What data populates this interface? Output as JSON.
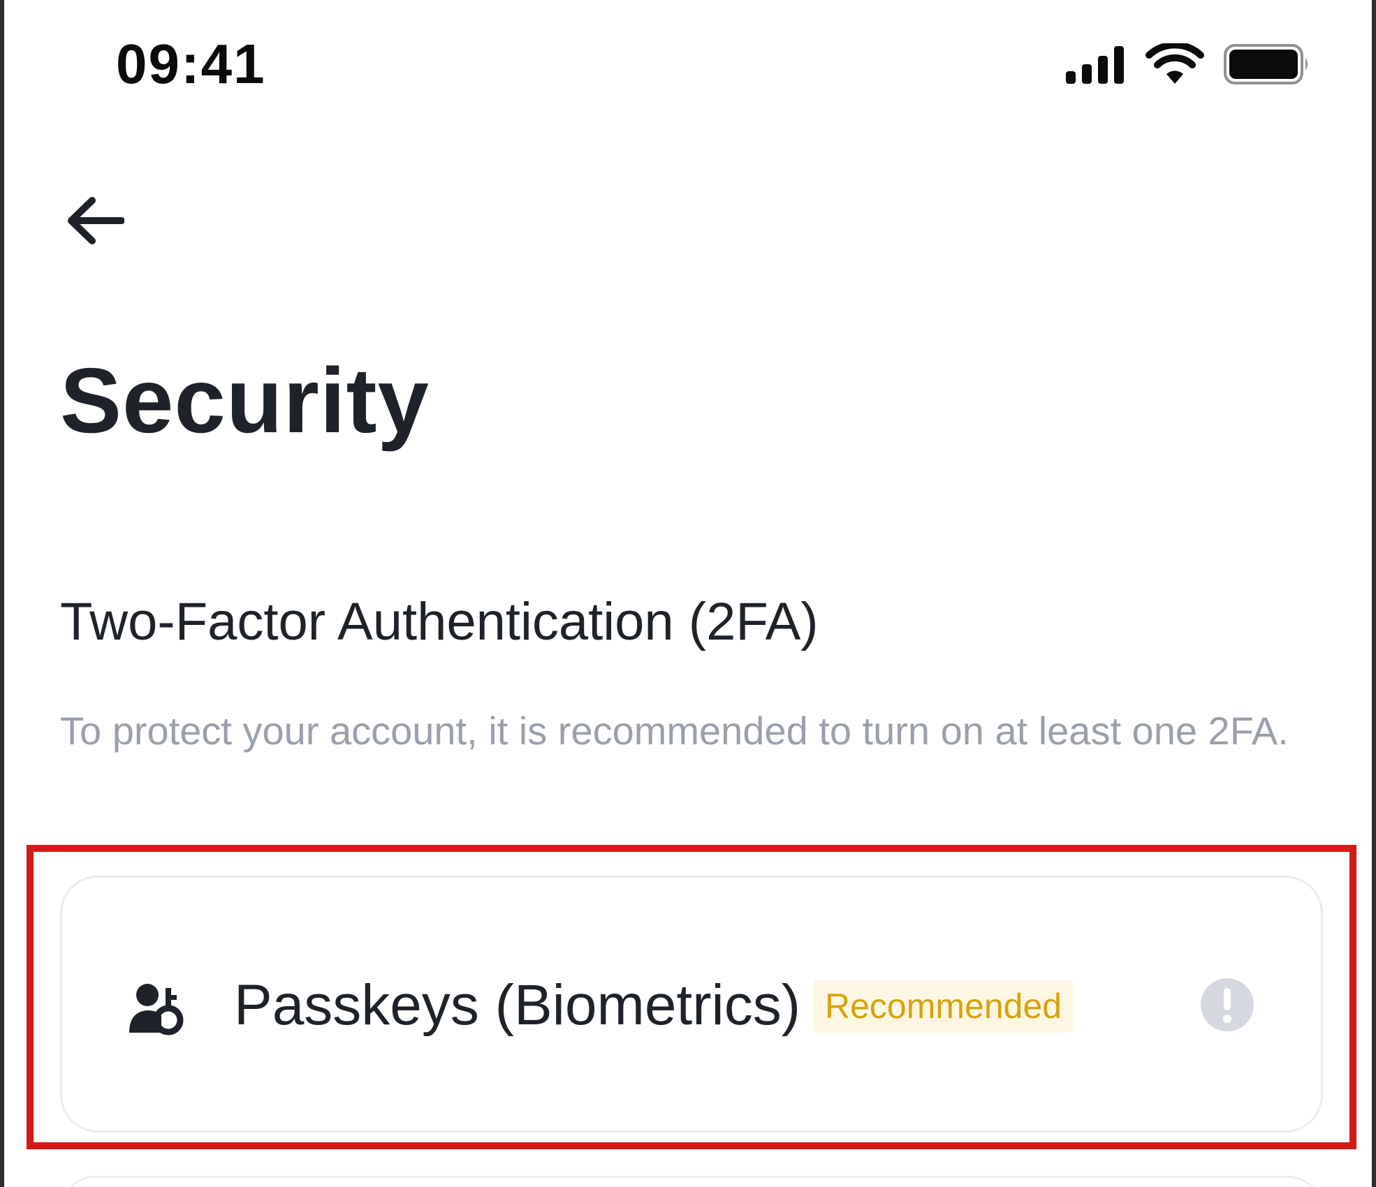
{
  "status_bar": {
    "time": "09:41",
    "icons": [
      "cellular-signal-icon",
      "wifi-icon",
      "battery-icon"
    ]
  },
  "nav": {
    "back_icon": "arrow-left-icon"
  },
  "page": {
    "title": "Security"
  },
  "two_factor": {
    "title": "Two-Factor Authentication (2FA)",
    "description": "To protect your account, it is recommended to turn on at least one 2FA.",
    "options": [
      {
        "icon": "passkey-biometrics-icon",
        "label": "Passkeys (Biometrics)",
        "badge": "Recommended",
        "status_icon": "alert-circle-icon"
      }
    ]
  },
  "colors": {
    "text_primary": "#1e2329",
    "text_secondary": "#9aa0ab",
    "badge_text": "#d8a20a",
    "badge_bg": "#fdf6e2",
    "highlight_frame": "#d21a17",
    "status_icon_fill": "#d5d8de"
  }
}
